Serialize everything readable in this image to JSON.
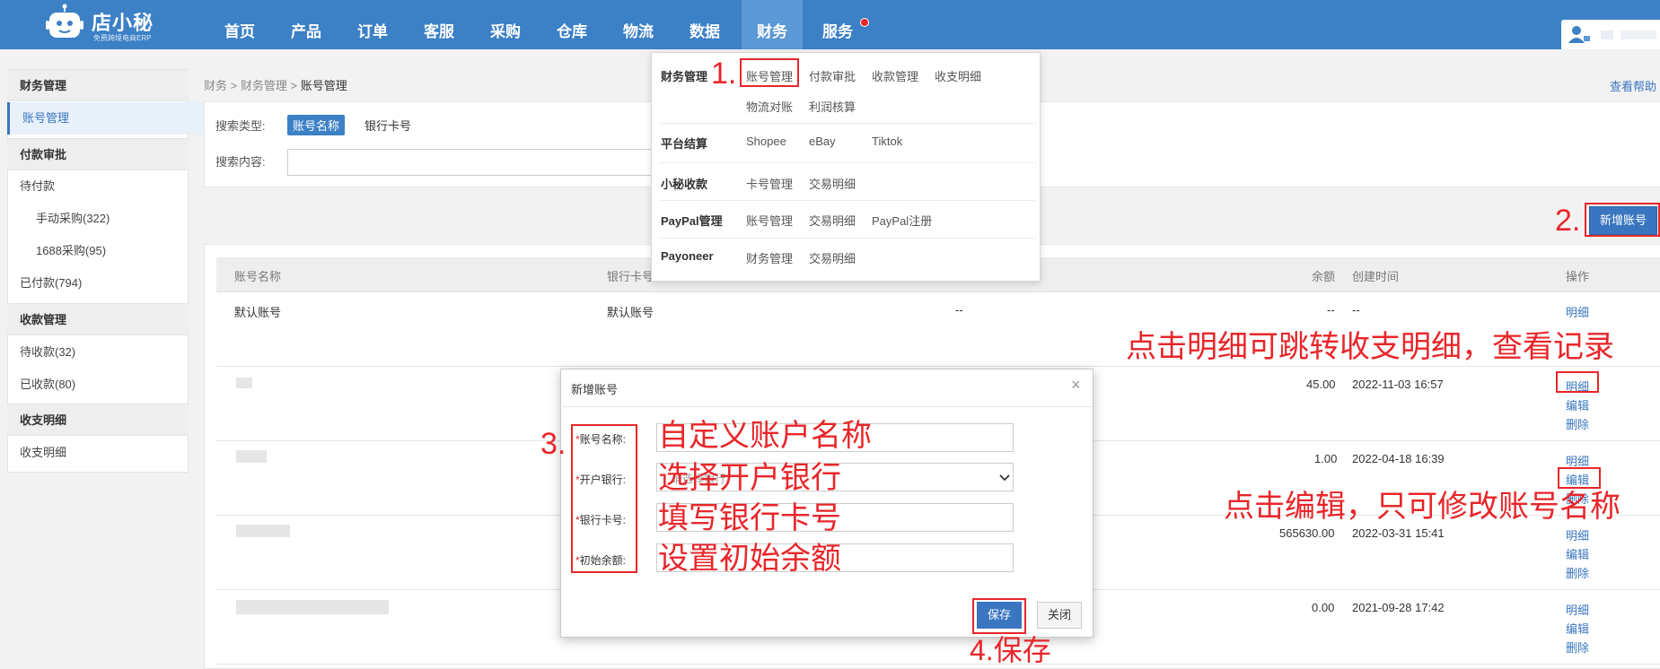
{
  "brand": {
    "name": "店小秘",
    "subtitle": "免费跨境电商ERP"
  },
  "nav": [
    "首页",
    "产品",
    "订单",
    "客服",
    "采购",
    "仓库",
    "物流",
    "数据",
    "财务",
    "服务"
  ],
  "sidebar": {
    "g1": "财务管理",
    "i1": "账号管理",
    "g2": "付款审批",
    "i2": "待付款",
    "i3": "手动采购(322)",
    "i4": "1688采购(95)",
    "i5": "已付款(794)",
    "g3": "收款管理",
    "i6": "待收款(32)",
    "i7": "已收款(80)",
    "g4": "收支明细",
    "i8": "收支明细"
  },
  "breadcrumb": {
    "a": "财务",
    "sep": ">",
    "b": "财务管理",
    "c": "账号管理"
  },
  "help": "查看帮助",
  "search": {
    "type_label": "搜索类型:",
    "opt1": "账号名称",
    "opt2": "银行卡号",
    "content_label": "搜索内容:"
  },
  "new_button": "新增账号",
  "table": {
    "headers": {
      "name": "账号名称",
      "card": "银行卡号",
      "balance": "余额",
      "created": "创建时间",
      "ops": "操作"
    },
    "rows": [
      {
        "name": "默认账号",
        "card": "默认账号",
        "mid": "--",
        "balance": "--",
        "created": "--"
      },
      {
        "balance": "45.00",
        "created": "2022-11-03 16:57"
      },
      {
        "balance": "1.00",
        "created": "2022-04-18 16:39"
      },
      {
        "balance": "565630.00",
        "created": "2022-03-31 15:41"
      },
      {
        "balance": "0.00",
        "created": "2021-09-28 17:42"
      }
    ],
    "op_detail": "明细",
    "op_edit": "编辑",
    "op_delete": "删除"
  },
  "dropdown": {
    "s1": "财务管理",
    "s1l1": "账号管理",
    "s1l2": "付款审批",
    "s1l3": "收款管理",
    "s1l4": "收支明细",
    "s1l5": "物流对账",
    "s1l6": "利润核算",
    "s2": "平台结算",
    "s2l1": "Shopee",
    "s2l2": "eBay",
    "s2l3": "Tiktok",
    "s3": "小秘收款",
    "s3l1": "卡号管理",
    "s3l2": "交易明细",
    "s4": "PayPal管理",
    "s4l1": "账号管理",
    "s4l2": "交易明细",
    "s4l3": "PayPal注册",
    "s5": "Payoneer",
    "s5l1": "财务管理",
    "s5l2": "交易明细"
  },
  "modal": {
    "title": "新增账号",
    "close": "×",
    "f1": "账号名称:",
    "f2": "开户银行:",
    "f3": "银行卡号:",
    "f4": "初始余额:",
    "star": "*",
    "select_hint": "请选择银行",
    "save": "保存",
    "cancel": "关闭"
  },
  "annotations": {
    "step1": "1.",
    "step2": "2.",
    "step3": "3.",
    "step4": "4.保存",
    "detail_note": "点击明细可跳转收支明细，查看记录",
    "edit_note": "点击编辑，只可修改账号名称",
    "f1_note": "自定义账户名称",
    "f2_note": "选择开户银行",
    "f3_note": "填写银行卡号",
    "f4_note": "设置初始余额"
  },
  "colors": {
    "header": "#3c80c6",
    "accent": "#3a76c0",
    "annotation": "#e8262a"
  }
}
